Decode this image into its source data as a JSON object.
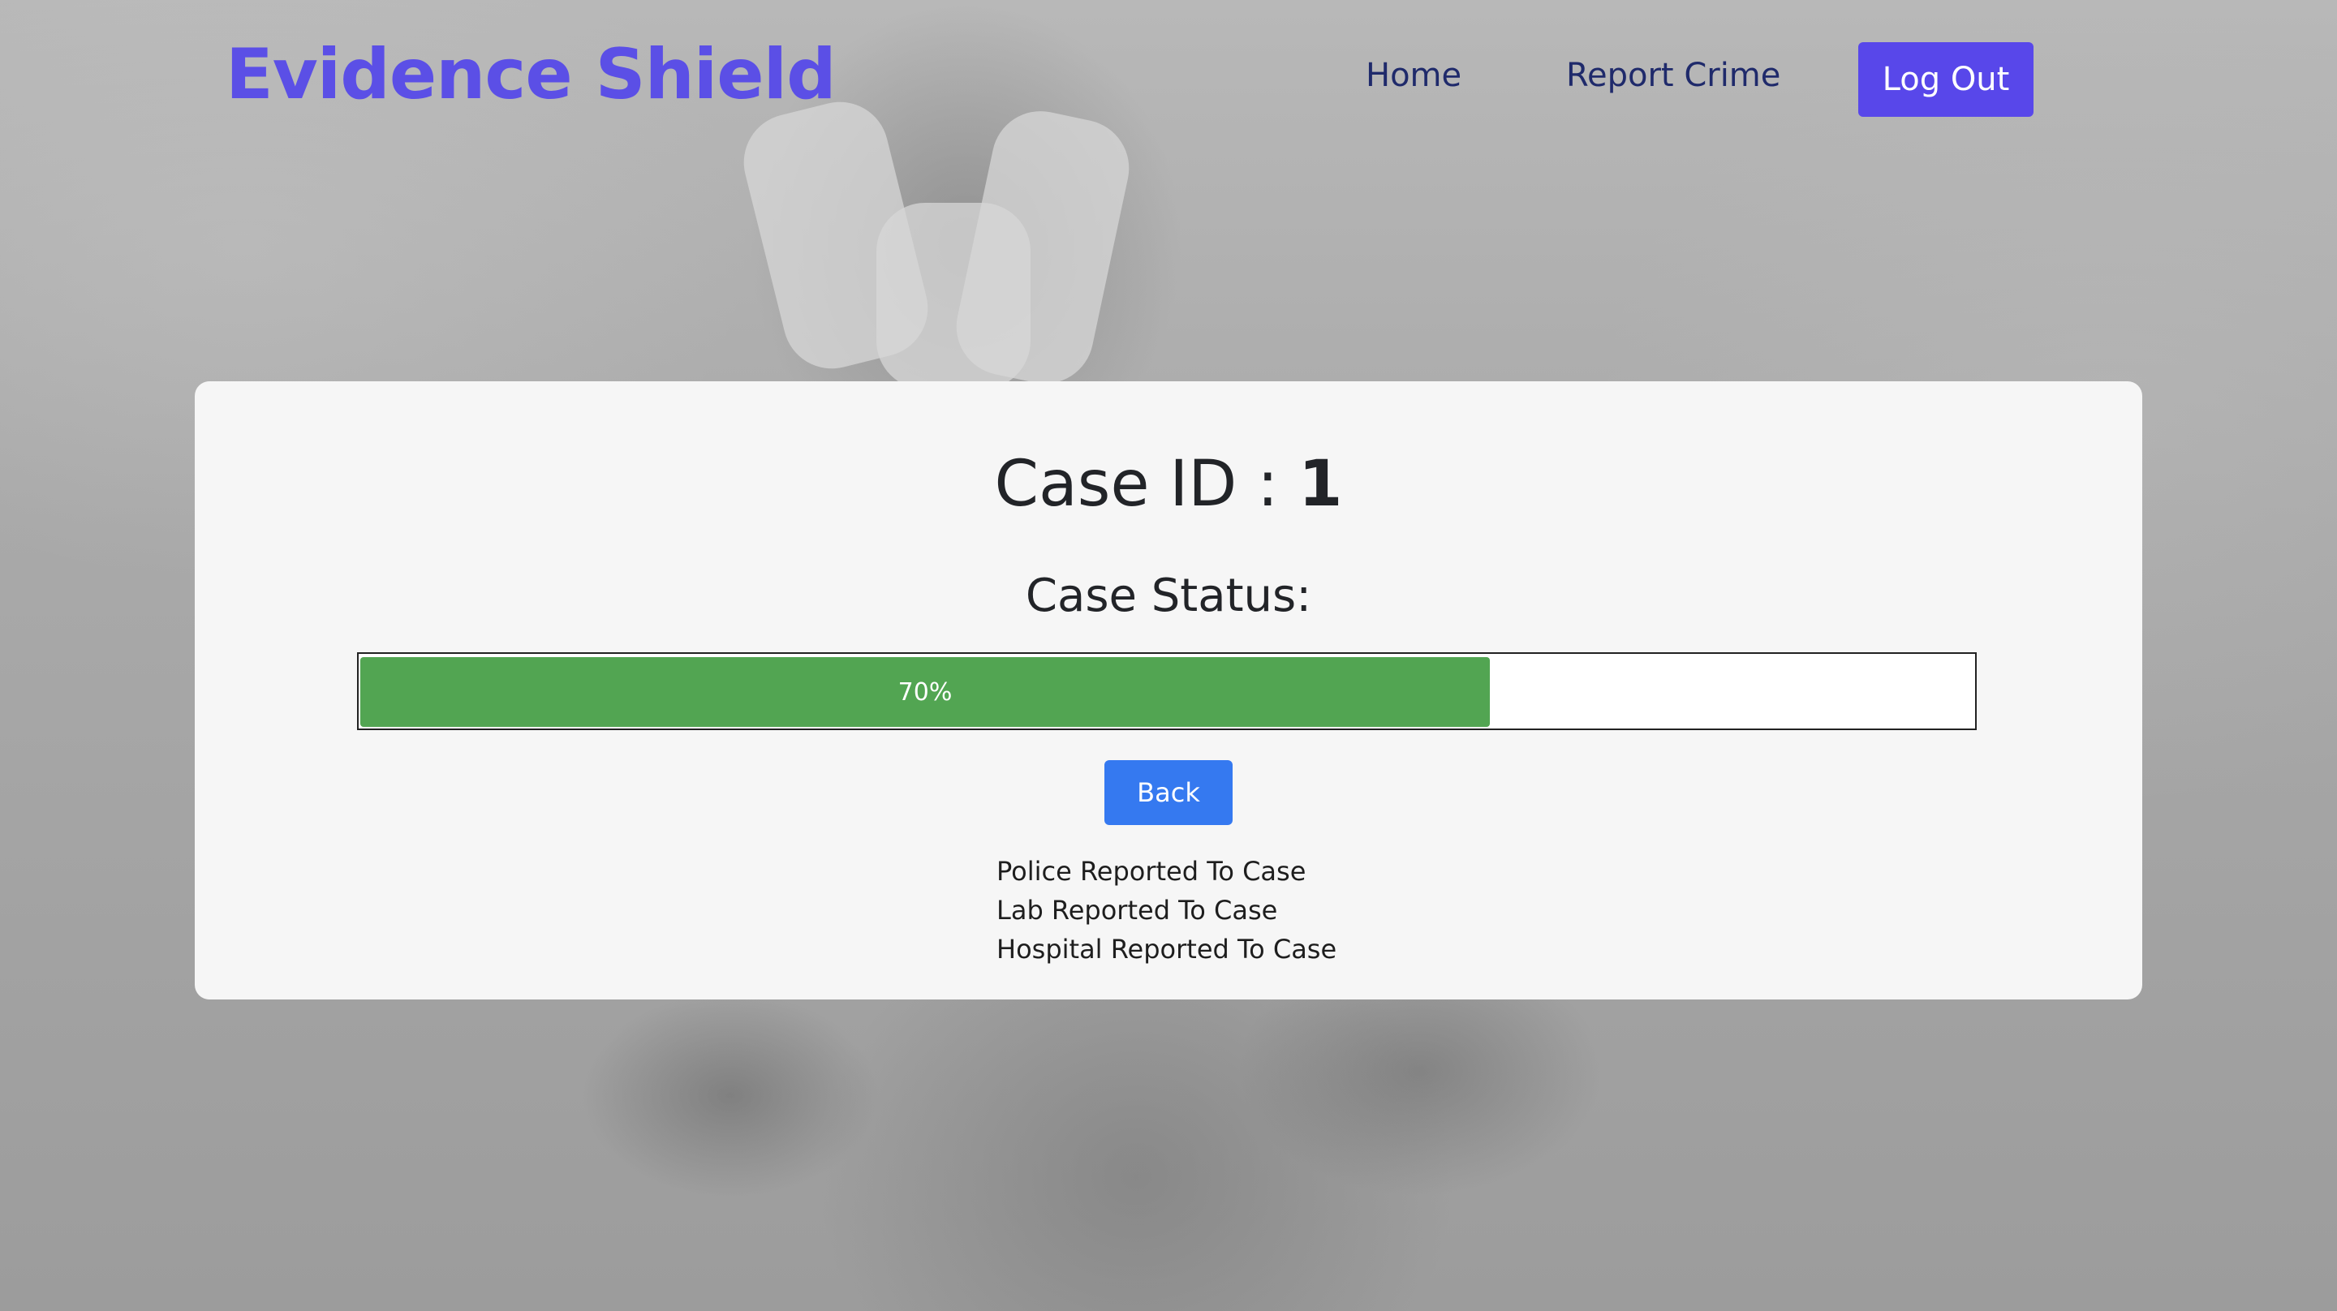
{
  "header": {
    "brand": "Evidence Shield",
    "nav": {
      "home_label": "Home",
      "report_label": "Report Crime",
      "logout_label": "Log Out"
    }
  },
  "card": {
    "case_id_label": "Case ID :",
    "case_id_value": "1",
    "status_label": "Case Status:",
    "progress": {
      "percent": 70,
      "text": "70%"
    },
    "back_label": "Back",
    "reports": [
      "Police Reported To Case",
      "Lab Reported To Case",
      "Hospital Reported To Case"
    ]
  },
  "colors": {
    "brand": "#5b4fe6",
    "nav_text": "#1f2a6b",
    "logout_bg": "#5847ea",
    "progress_fill": "#52a552",
    "back_bg": "#3579f0",
    "card_bg": "#f6f6f6"
  }
}
